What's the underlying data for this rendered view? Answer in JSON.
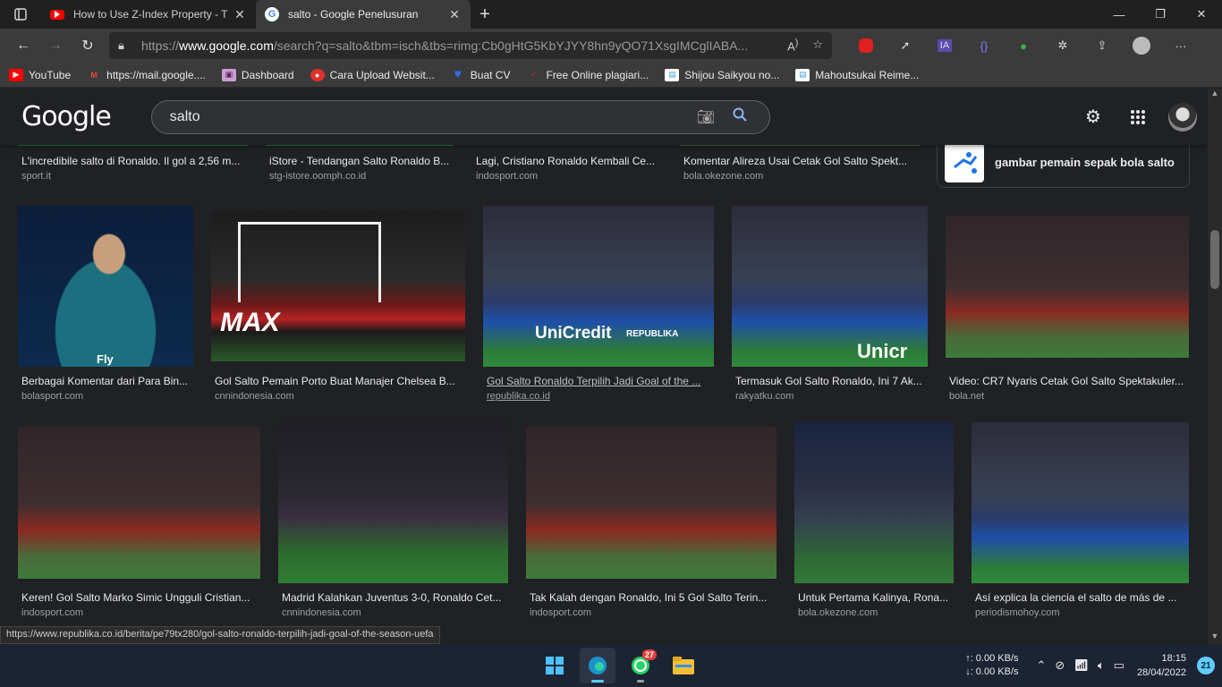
{
  "tabs": [
    {
      "title": "How to Use Z-Index Property - T",
      "active": false
    },
    {
      "title": "salto - Google Penelusuran",
      "active": true
    }
  ],
  "address": {
    "url_prefix": "https://",
    "url_domain": "www.google.com",
    "url_rest": "/search?q=salto&tbm=isch&tbs=rimg:Cb0gHtG5KbYJYY8hn9yQO71XsgIMCglIABA..."
  },
  "bookmarks": [
    {
      "label": "YouTube",
      "icon": "youtube-icon",
      "color": "#ff0000"
    },
    {
      "label": "https://mail.google....",
      "icon": "gmail-icon",
      "color": "#ea4335"
    },
    {
      "label": "Dashboard",
      "icon": "dashboard-icon",
      "color": "#c9a0d0"
    },
    {
      "label": "Cara Upload Websit...",
      "icon": "upload-icon",
      "color": "#e0302a"
    },
    {
      "label": "Buat CV",
      "icon": "cv-icon",
      "color": "#2d6cdf"
    },
    {
      "label": "Free Online plagiari...",
      "icon": "check-icon",
      "color": "#d93025"
    },
    {
      "label": "Shijou Saikyou no...",
      "icon": "book-icon",
      "color": "#4aa3df"
    },
    {
      "label": "Mahoutsukai Reime...",
      "icon": "book-icon",
      "color": "#4aa3df"
    }
  ],
  "google": {
    "logo": "Google",
    "query": "salto"
  },
  "related": {
    "text": "gambar pemain sepak bola salto"
  },
  "results_row0": [
    {
      "caption": "L'incredibile salto di Ronaldo. Il gol a 2,56 m...",
      "source": "sport.it"
    },
    {
      "caption": "iStore - Tendangan Salto Ronaldo B...",
      "source": "stg-istore.oomph.co.id"
    },
    {
      "caption": "Lagi, Cristiano Ronaldo Kembali Ce...",
      "source": "indosport.com"
    },
    {
      "caption": "Komentar Alireza Usai Cetak Gol Salto Spekt...",
      "source": "bola.okezone.com"
    }
  ],
  "results_row1": [
    {
      "caption": "Berbagai Komentar dari Para Bin...",
      "source": "bolasport.com"
    },
    {
      "caption": "Gol Salto Pemain Porto Buat Manajer Chelsea B...",
      "source": "cnnindonesia.com"
    },
    {
      "caption": "Gol Salto Ronaldo Terpilih Jadi Goal of the ...",
      "source": "republika.co.id"
    },
    {
      "caption": "Termasuk Gol Salto Ronaldo, Ini 7 Ak...",
      "source": "rakyatku.com"
    },
    {
      "caption": "Video: CR7 Nyaris Cetak Gol Salto Spektakuler...",
      "source": "bola.net"
    }
  ],
  "results_row2": [
    {
      "caption": "Keren! Gol Salto Marko Simic Ungguli Cristian...",
      "source": "indosport.com"
    },
    {
      "caption": "Madrid Kalahkan Juventus 3-0, Ronaldo Cet...",
      "source": "cnnindonesia.com"
    },
    {
      "caption": "Tak Kalah dengan Ronaldo, Ini 5 Gol Salto Terin...",
      "source": "indosport.com"
    },
    {
      "caption": "Untuk Pertama Kalinya, Rona...",
      "source": "bola.okezone.com"
    },
    {
      "caption": "Así explica la ciencia el salto de más de ...",
      "source": "periodismohoy.com"
    }
  ],
  "image_overlays": {
    "fly": "Fly",
    "max": "MAX",
    "unicredit": "UniCredit",
    "republika": "REPUBLIKA",
    "unicr2": "Unicr"
  },
  "status_url": "https://www.republika.co.id/berita/pe79tx280/gol-salto-ronaldo-terpilih-jadi-goal-of-the-season-uefa",
  "taskbar": {
    "whatsapp_badge": "27",
    "net_up": "↑: 0.00 KB/s",
    "net_down": "↓: 0.00 KB/s",
    "time": "18:15",
    "date": "28/04/2022",
    "notifications": "21"
  }
}
